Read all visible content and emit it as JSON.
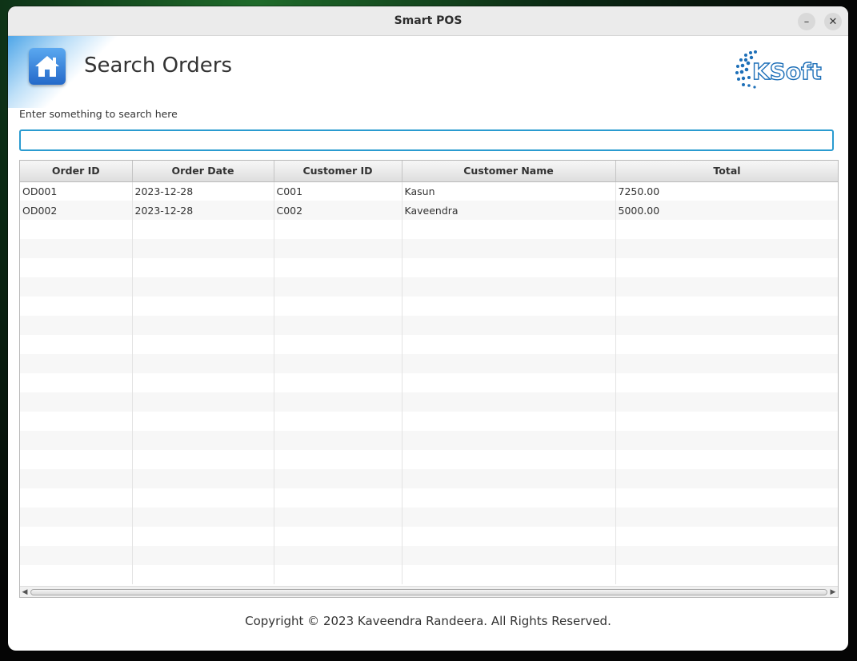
{
  "window": {
    "title": "Smart POS",
    "minimize_label": "–",
    "close_label": "✕"
  },
  "header": {
    "title": "Search Orders",
    "logo_text": "KSoft",
    "home_icon": "home-icon"
  },
  "search": {
    "label": "Enter something to search here",
    "value": "",
    "placeholder": ""
  },
  "table": {
    "columns": [
      "Order ID",
      "Order Date",
      "Customer ID",
      "Customer Name",
      "Total"
    ],
    "rows": [
      [
        "OD001",
        "2023-12-28",
        "C001",
        "Kasun",
        "7250.00"
      ],
      [
        "OD002",
        "2023-12-28",
        "C002",
        "Kaveendra",
        "5000.00"
      ]
    ]
  },
  "footer": {
    "copyright": "Copyright © 2023 Kaveendra Randeera. All Rights Reserved."
  },
  "colors": {
    "accent": "#2a9bd0",
    "home_icon": "#2469c9",
    "logo": "#1d6fb8"
  }
}
